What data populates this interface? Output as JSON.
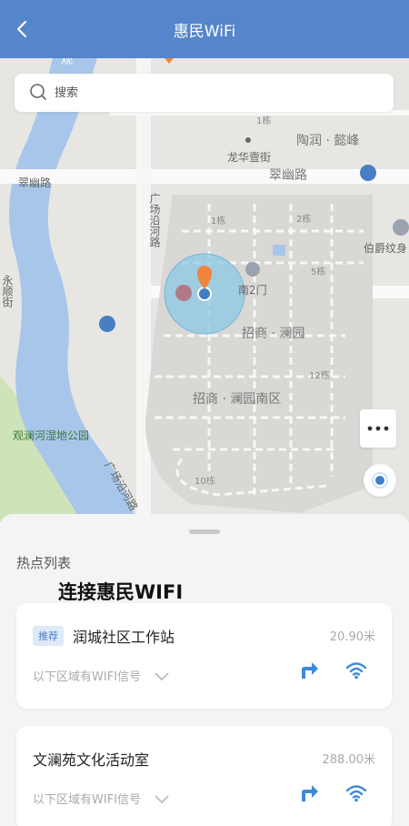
{
  "header": {
    "title": "惠民WiFi",
    "back_icon": "chevron-left-icon"
  },
  "search": {
    "placeholder": "搜索",
    "value": ""
  },
  "map": {
    "labels": {
      "river": "观",
      "taorun": "陶润 · 懿峰",
      "longhua": "龙华壹街",
      "cuiyou_road_left": "翠幽路",
      "cuiyou_road_right": "翠幽路",
      "guangchang_road": "广场沿河路",
      "building_1a": "1栋",
      "building_1b": "1栋",
      "building_2": "2栋",
      "building_5": "5栋",
      "building_12": "12栋",
      "building_10": "10栋",
      "south_gate": "南2门",
      "zhaoshang_lanyuan": "招商 · 澜园",
      "zhaoshang_south": "招商 · 澜园南区",
      "bojue": "伯爵纹身",
      "park": "观澜河湿地公园",
      "yong": "永顺街",
      "guangchang_road_2": "广场沿河路"
    }
  },
  "sheet": {
    "section_title": "热点列表",
    "overlay_title": "连接惠民WIFI"
  },
  "hotspots": [
    {
      "tag": "推荐",
      "name": "润城社区工作站",
      "distance": "20.90米",
      "signal_text": "以下区域有WIFI信号"
    },
    {
      "tag": "",
      "name": "文澜苑文化活动室",
      "distance": "288.00米",
      "signal_text": "以下区域有WIFI信号"
    }
  ],
  "colors": {
    "header": "#5585cb",
    "accent": "#4a90d9",
    "river": "#a8c6ea",
    "park": "#cfe3b8",
    "pin": "#f0843a"
  }
}
